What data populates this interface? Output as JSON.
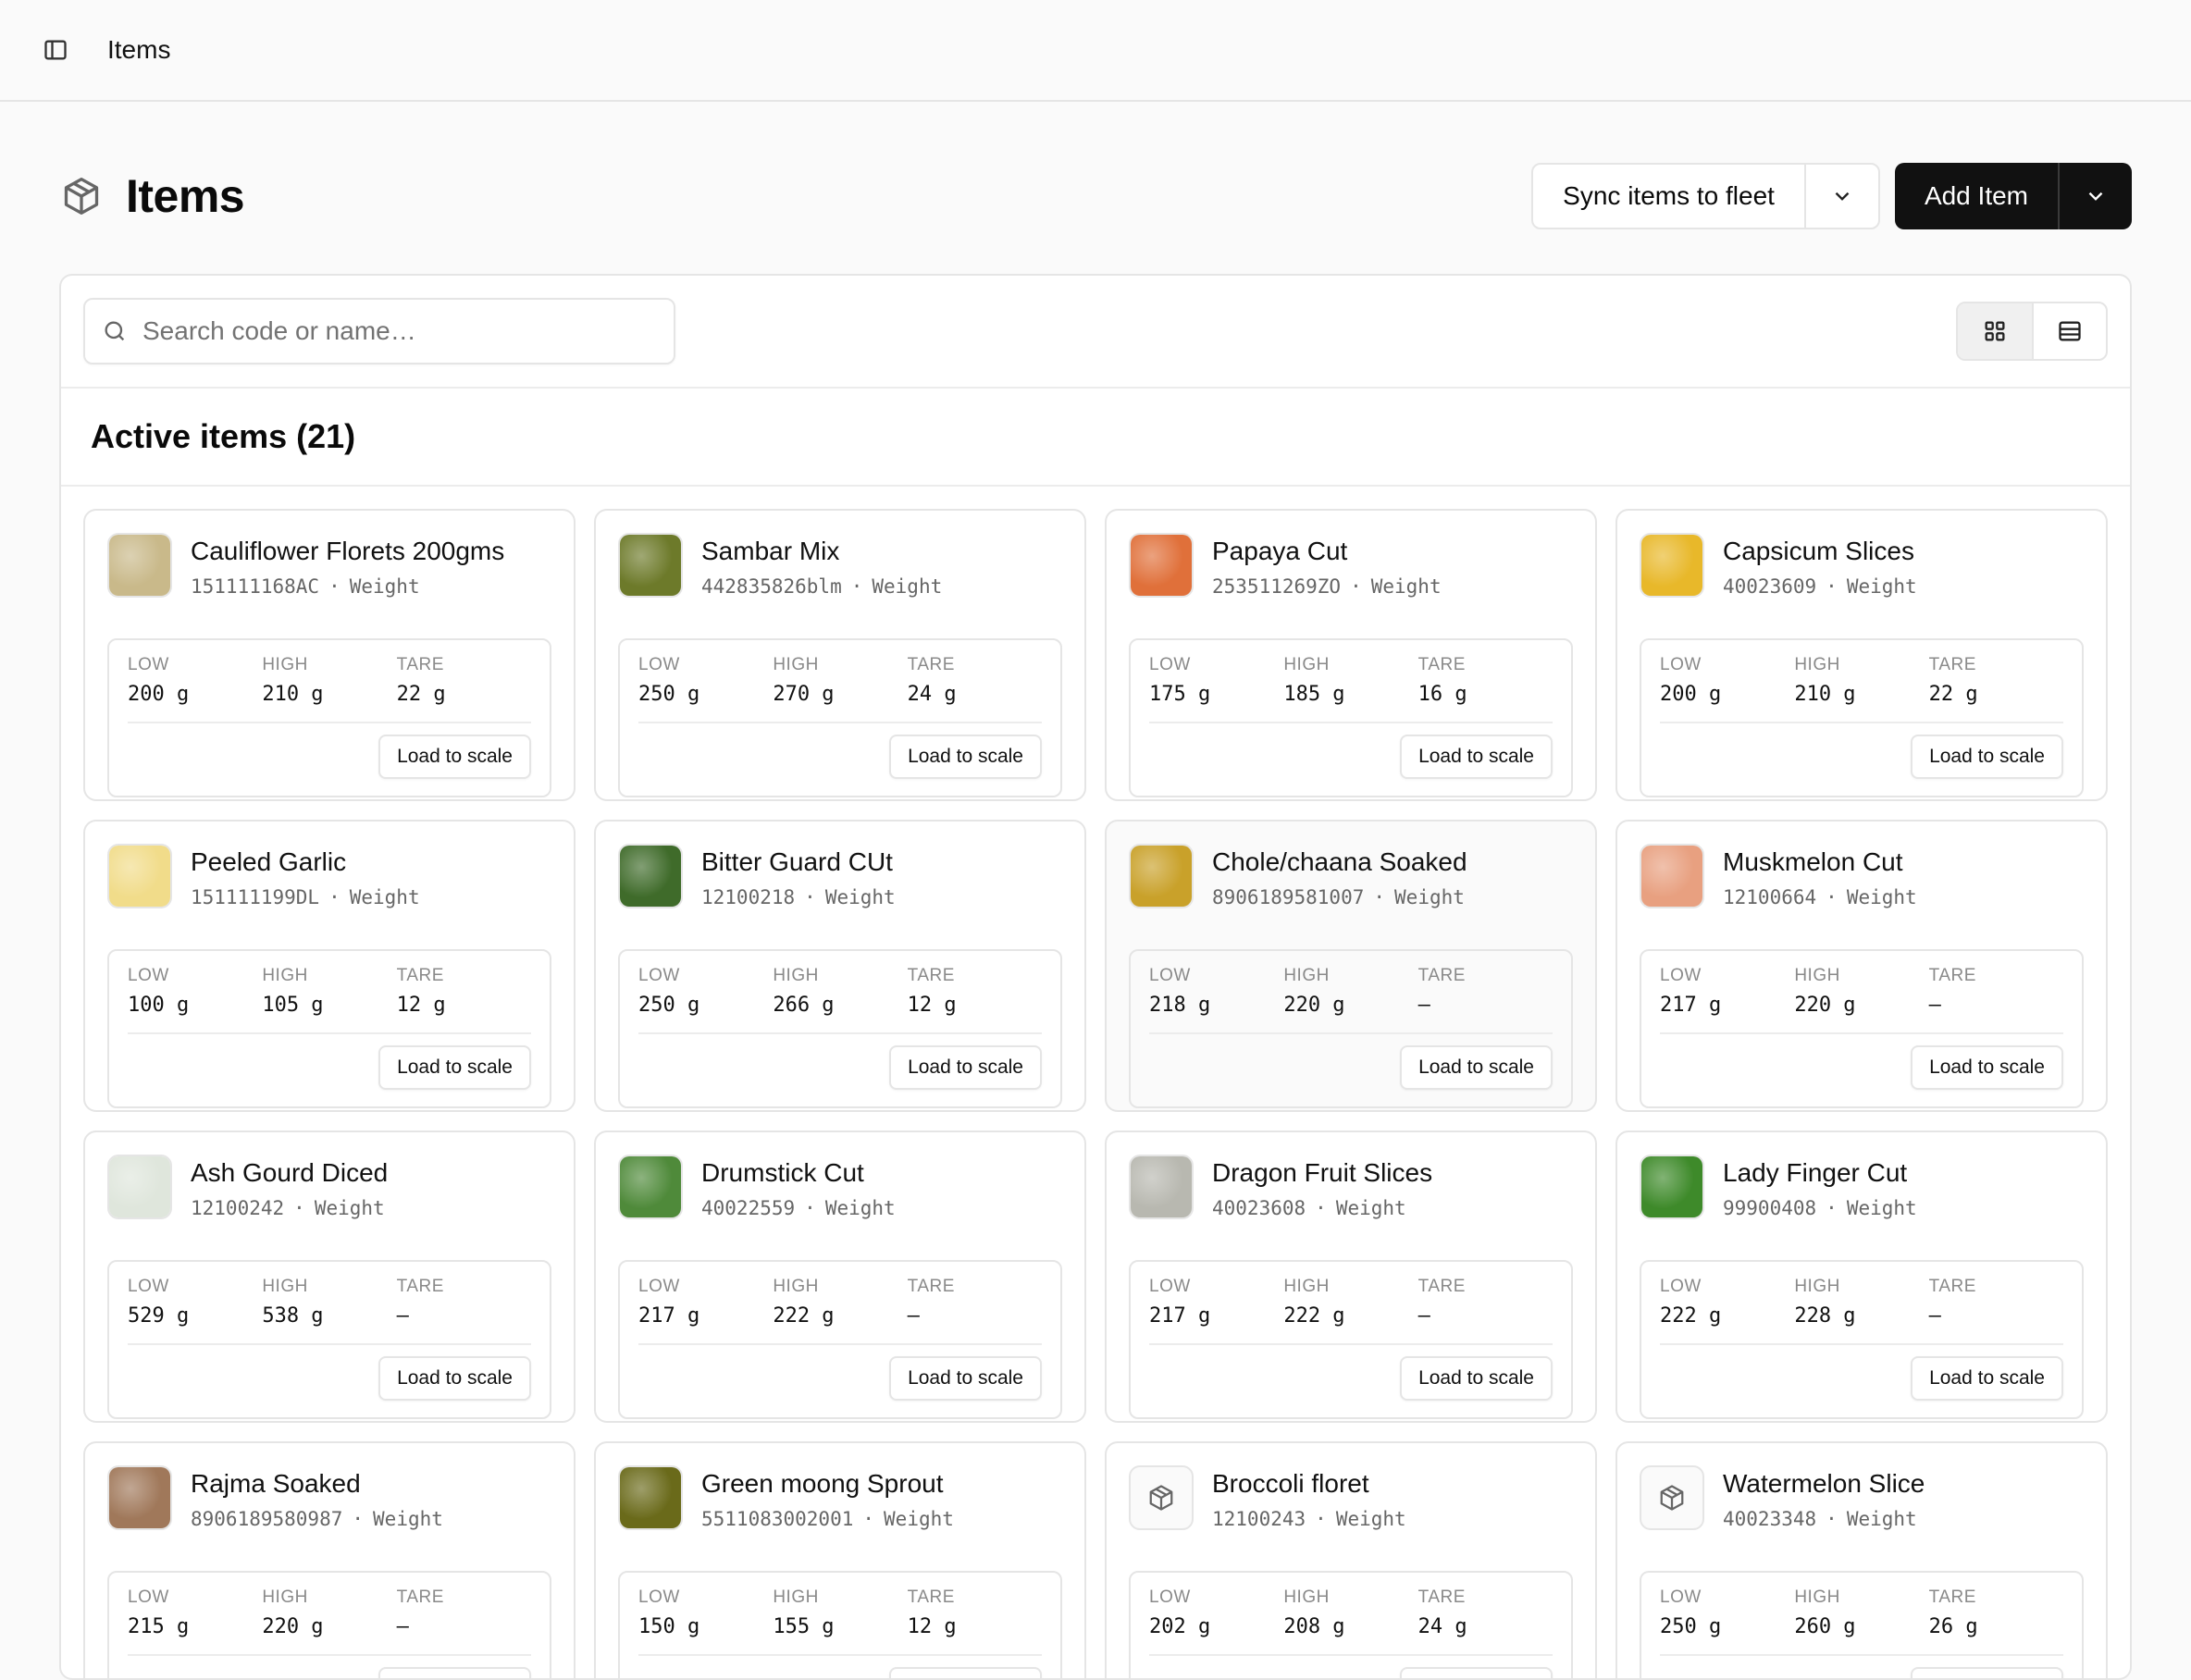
{
  "topbar": {
    "breadcrumb": "Items"
  },
  "header": {
    "title": "Items",
    "sync_label": "Sync items to fleet",
    "add_label": "Add Item"
  },
  "search": {
    "placeholder": "Search code or name…"
  },
  "section": {
    "title": "Active items (21)"
  },
  "labels": {
    "low": "LOW",
    "high": "HIGH",
    "tare": "TARE",
    "load": "Load to scale"
  },
  "items": [
    {
      "name": "Cauliflower Florets 200gms",
      "code": "151111168AC",
      "type": "Weight",
      "low": "200 g",
      "high": "210 g",
      "tare": "22 g",
      "thumb_color": "#c9b98a",
      "placeholder": false
    },
    {
      "name": "Sambar Mix",
      "code": "442835826blm",
      "type": "Weight",
      "low": "250 g",
      "high": "270 g",
      "tare": "24 g",
      "thumb_color": "#6d7a2a",
      "placeholder": false
    },
    {
      "name": "Papaya Cut",
      "code": "253511269ZO",
      "type": "Weight",
      "low": "175 g",
      "high": "185 g",
      "tare": "16 g",
      "thumb_color": "#e0703a",
      "placeholder": false
    },
    {
      "name": "Capsicum Slices",
      "code": "40023609",
      "type": "Weight",
      "low": "200 g",
      "high": "210 g",
      "tare": "22 g",
      "thumb_color": "#e8b82a",
      "placeholder": false
    },
    {
      "name": "Peeled Garlic",
      "code": "151111199DL",
      "type": "Weight",
      "low": "100 g",
      "high": "105 g",
      "tare": "12 g",
      "thumb_color": "#f1dc8a",
      "placeholder": false
    },
    {
      "name": "Bitter Guard CUt",
      "code": "12100218",
      "type": "Weight",
      "low": "250 g",
      "high": "266 g",
      "tare": "12 g",
      "thumb_color": "#3f6b2a",
      "placeholder": false
    },
    {
      "name": "Chole/chaana Soaked",
      "code": "8906189581007",
      "type": "Weight",
      "low": "218 g",
      "high": "220 g",
      "tare": "–",
      "thumb_color": "#c9a12a",
      "placeholder": false
    },
    {
      "name": "Muskmelon Cut",
      "code": "12100664",
      "type": "Weight",
      "low": "217 g",
      "high": "220 g",
      "tare": "–",
      "thumb_color": "#e8a080",
      "placeholder": false
    },
    {
      "name": "Ash Gourd Diced",
      "code": "12100242",
      "type": "Weight",
      "low": "529 g",
      "high": "538 g",
      "tare": "–",
      "thumb_color": "#dfe6dc",
      "placeholder": false
    },
    {
      "name": "Drumstick Cut",
      "code": "40022559",
      "type": "Weight",
      "low": "217 g",
      "high": "222 g",
      "tare": "–",
      "thumb_color": "#4f8a3a",
      "placeholder": false
    },
    {
      "name": "Dragon Fruit Slices",
      "code": "40023608",
      "type": "Weight",
      "low": "217 g",
      "high": "222 g",
      "tare": "–",
      "thumb_color": "#b8b8b0",
      "placeholder": false
    },
    {
      "name": "Lady Finger Cut",
      "code": "99900408",
      "type": "Weight",
      "low": "222 g",
      "high": "228 g",
      "tare": "–",
      "thumb_color": "#3e8a2a",
      "placeholder": false
    },
    {
      "name": "Rajma Soaked",
      "code": "8906189580987",
      "type": "Weight",
      "low": "215 g",
      "high": "220 g",
      "tare": "–",
      "thumb_color": "#a0785a",
      "placeholder": false
    },
    {
      "name": "Green moong Sprout",
      "code": "5511083002001",
      "type": "Weight",
      "low": "150 g",
      "high": "155 g",
      "tare": "12 g",
      "thumb_color": "#6a6a1a",
      "placeholder": false
    },
    {
      "name": "Broccoli floret",
      "code": "12100243",
      "type": "Weight",
      "low": "202 g",
      "high": "208 g",
      "tare": "24 g",
      "thumb_color": "#ffffff",
      "placeholder": true
    },
    {
      "name": "Watermelon Slice",
      "code": "40023348",
      "type": "Weight",
      "low": "250 g",
      "high": "260 g",
      "tare": "26 g",
      "thumb_color": "#ffffff",
      "placeholder": true
    }
  ]
}
